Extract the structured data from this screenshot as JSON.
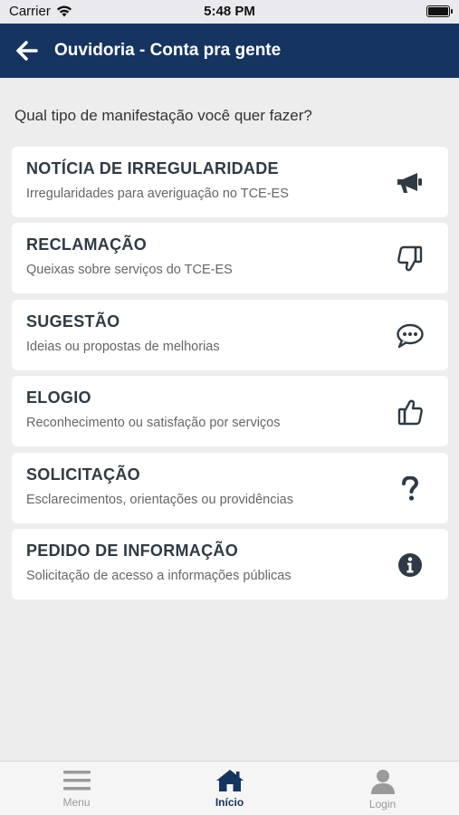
{
  "status_bar": {
    "carrier": "Carrier",
    "time": "5:48 PM"
  },
  "header": {
    "title": "Ouvidoria - Conta pra gente",
    "back_icon": "arrow-left-icon"
  },
  "prompt": "Qual tipo de manifestação você quer fazer?",
  "options": [
    {
      "title": "NOTÍCIA DE IRREGULARIDADE",
      "subtitle": "Irregularidades para averiguação no TCE-ES",
      "icon": "megaphone-icon"
    },
    {
      "title": "RECLAMAÇÃO",
      "subtitle": "Queixas sobre serviços do TCE-ES",
      "icon": "thumbs-down-icon"
    },
    {
      "title": "SUGESTÃO",
      "subtitle": "Ideias ou propostas de melhorias",
      "icon": "chat-bubble-icon"
    },
    {
      "title": "ELOGIO",
      "subtitle": "Reconhecimento ou satisfação por serviços",
      "icon": "thumbs-up-icon"
    },
    {
      "title": "SOLICITAÇÃO",
      "subtitle": "Esclarecimentos, orientações ou providências",
      "icon": "question-icon"
    },
    {
      "title": "PEDIDO DE INFORMAÇÃO",
      "subtitle": "Solicitação de acesso a informações públicas",
      "icon": "info-icon"
    }
  ],
  "tabs": [
    {
      "label": "Menu",
      "icon": "menu-icon",
      "active": false
    },
    {
      "label": "Início",
      "icon": "home-icon",
      "active": true
    },
    {
      "label": "Login",
      "icon": "user-icon",
      "active": false
    }
  ],
  "colors": {
    "header": "#163460",
    "background": "#ededed",
    "active_tab": "#163460",
    "inactive_tab": "#9a9a9a"
  }
}
